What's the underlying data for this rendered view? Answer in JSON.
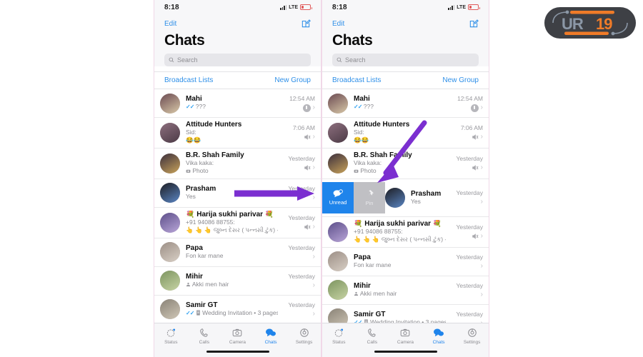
{
  "page": {
    "background": "#ffffff",
    "frame_border_color": "#f0d8e8"
  },
  "logo": {
    "name": "ur19-logo",
    "text_primary": "UR",
    "text_accent": "19",
    "body_color": "#3e4045",
    "accent_color": "#f07b28",
    "letter_color": "#8b97a6"
  },
  "status_bar": {
    "time": "8:18",
    "network_label": "LTE",
    "signal_icon": "signal-bars-icon",
    "battery_icon": "battery-low-icon"
  },
  "header": {
    "edit_label": "Edit",
    "compose_icon": "compose-icon",
    "title": "Chats"
  },
  "search": {
    "placeholder": "Search",
    "icon": "search-icon"
  },
  "broadcast_row": {
    "left_label": "Broadcast Lists",
    "right_label": "New Group",
    "link_color": "#2e8fe8"
  },
  "swipe_actions": {
    "unread": {
      "label": "Unread",
      "icon": "unread-bubble-icon",
      "color": "#1f84eb"
    },
    "pin": {
      "label": "Pin",
      "icon": "pin-icon",
      "color": "#c0c0c4"
    }
  },
  "chats": [
    {
      "name": "Mahi",
      "preview": "???",
      "preview2": "",
      "time": "12:54 AM",
      "tick": "✓✓",
      "muted": true,
      "mute_style": "circle",
      "avatar_a": "#6b4a52",
      "avatar_b": "#d9c9a8",
      "prefix_icon": ""
    },
    {
      "name": "Attitude Hunters",
      "preview": "Sid:",
      "preview2": "😂😂",
      "time": "7:06 AM",
      "tick": "",
      "muted": true,
      "mute_style": "speaker",
      "avatar_a": "#8d6f7e",
      "avatar_b": "#4c3b46",
      "prefix_icon": ""
    },
    {
      "name": "B.R. Shah Family",
      "preview": "Vika kaka:",
      "preview2": "Photo",
      "time": "Yesterday",
      "tick": "",
      "muted": true,
      "mute_style": "speaker",
      "avatar_a": "#3a2e3c",
      "avatar_b": "#c9a35a",
      "prefix_icon": "camera-icon"
    },
    {
      "name": "Prasham",
      "preview": "Yes",
      "preview2": "",
      "time": "Yesterday",
      "tick": "",
      "muted": false,
      "mute_style": "",
      "avatar_a": "#1d1d22",
      "avatar_b": "#5a86c4",
      "prefix_icon": ""
    },
    {
      "name": "💐 Harija sukhi parivar 💐",
      "preview": "+91 94086 88755:",
      "preview2": "👆 👆 👆 જુબ્ન દેસર ( પન્નસી ટુંક) -ની...",
      "time": "Yesterday",
      "tick": "",
      "muted": true,
      "mute_style": "speaker",
      "avatar_a": "#5d4f8a",
      "avatar_b": "#b9a6d8",
      "prefix_icon": ""
    },
    {
      "name": "Papa",
      "preview": "Fon kar mane",
      "preview2": "",
      "time": "Yesterday",
      "tick": "",
      "muted": false,
      "mute_style": "",
      "avatar_a": "#9c8f86",
      "avatar_b": "#d8cfc5",
      "prefix_icon": ""
    },
    {
      "name": "Mihir",
      "preview": "Akki men hair",
      "preview2": "",
      "time": "Yesterday",
      "tick": "",
      "muted": false,
      "mute_style": "",
      "avatar_a": "#7d9560",
      "avatar_b": "#c7d3a4",
      "prefix_icon": "person-icon"
    },
    {
      "name": "Samir GT",
      "preview": "Wedding Invitation • 3 pages",
      "preview2": "",
      "time": "Yesterday",
      "tick": "✓✓",
      "muted": false,
      "mute_style": "",
      "avatar_a": "#8a8377",
      "avatar_b": "#cfc6b6",
      "prefix_icon": "document-icon"
    }
  ],
  "tabs": [
    {
      "label": "Status",
      "icon": "status-ring-icon",
      "active": false
    },
    {
      "label": "Calls",
      "icon": "phone-icon",
      "active": false
    },
    {
      "label": "Camera",
      "icon": "camera-icon",
      "active": false
    },
    {
      "label": "Chats",
      "icon": "chat-bubble-icon",
      "active": true
    },
    {
      "label": "Settings",
      "icon": "settings-icon",
      "active": false
    }
  ],
  "annotations": {
    "arrow_color": "#7b2fd0",
    "left_arrow": "swipe-left-gesture-arrow",
    "right_arrow": "pin-button-pointer-arrow"
  }
}
